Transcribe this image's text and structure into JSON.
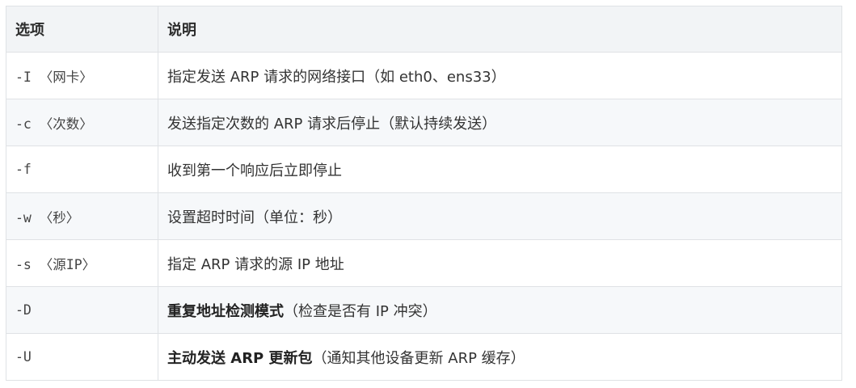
{
  "table": {
    "headers": [
      "选项",
      "说明"
    ],
    "rows": [
      {
        "option": "-I 〈网卡〉",
        "strong": "",
        "desc": "指定发送 ARP 请求的网络接口（如 eth0、ens33）"
      },
      {
        "option": "-c 〈次数〉",
        "strong": "",
        "desc": "发送指定次数的 ARP 请求后停止（默认持续发送）"
      },
      {
        "option": "-f",
        "strong": "",
        "desc": "收到第一个响应后立即停止"
      },
      {
        "option": "-w 〈秒〉",
        "strong": "",
        "desc": "设置超时时间（单位：秒）"
      },
      {
        "option": "-s 〈源IP〉",
        "strong": "",
        "desc": "指定 ARP 请求的源 IP 地址"
      },
      {
        "option": "-D",
        "strong": "重复地址检测模式",
        "desc": "（检查是否有 IP 冲突）"
      },
      {
        "option": "-U",
        "strong": "主动发送 ARP 更新包",
        "desc": "（通知其他设备更新 ARP 缓存）"
      }
    ]
  }
}
